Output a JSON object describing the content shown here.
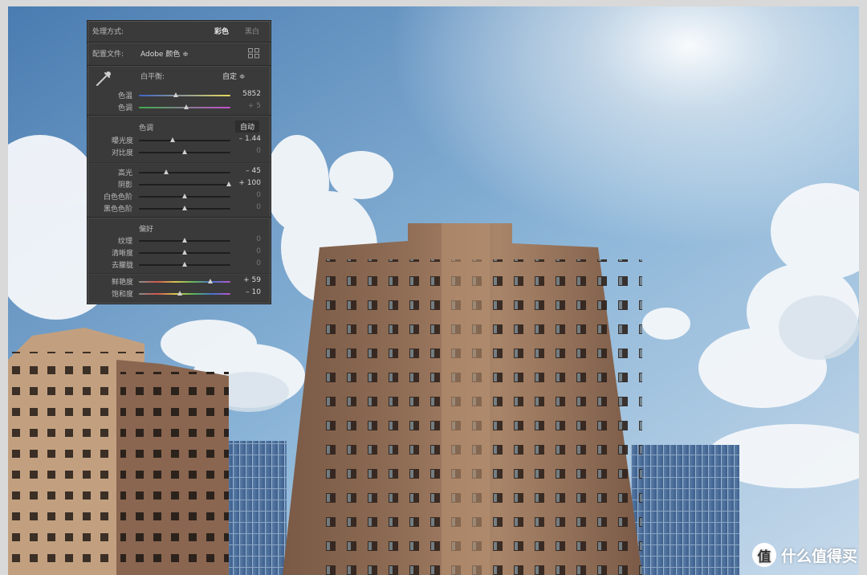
{
  "panel": {
    "treatment": {
      "label": "处理方式:",
      "color": "彩色",
      "bw": "黑白"
    },
    "profile": {
      "label": "配置文件:",
      "value": "Adobe 颜色 ≑"
    },
    "wb": {
      "label": "白平衡:",
      "mode": "自定 ≑",
      "temp": {
        "label": "色温",
        "value": "5852",
        "level": 0.4
      },
      "tint": {
        "label": "色调",
        "value": "+ 5",
        "level": 0.52
      }
    },
    "tone": {
      "title": "色调",
      "auto": "自动",
      "exposure": {
        "label": "曝光度",
        "value": "– 1.44",
        "level": 0.37
      },
      "contrast": {
        "label": "对比度",
        "value": "0",
        "level": 0.5
      },
      "highlights": {
        "label": "高光",
        "value": "– 45",
        "level": 0.3
      },
      "shadows": {
        "label": "阴影",
        "value": "+ 100",
        "level": 0.98
      },
      "whites": {
        "label": "白色色阶",
        "value": "0",
        "level": 0.5
      },
      "blacks": {
        "label": "黑色色阶",
        "value": "0",
        "level": 0.5
      }
    },
    "presence": {
      "title": "偏好",
      "texture": {
        "label": "纹理",
        "value": "0",
        "level": 0.5
      },
      "clarity": {
        "label": "清晰度",
        "value": "0",
        "level": 0.5
      },
      "dehaze": {
        "label": "去朦胧",
        "value": "0",
        "level": 0.5
      },
      "vibrance": {
        "label": "鲜艳度",
        "value": "+ 59",
        "level": 0.78
      },
      "saturation": {
        "label": "饱和度",
        "value": "– 10",
        "level": 0.45
      }
    }
  },
  "watermark": {
    "badge": "值",
    "text": "什么值得买"
  }
}
